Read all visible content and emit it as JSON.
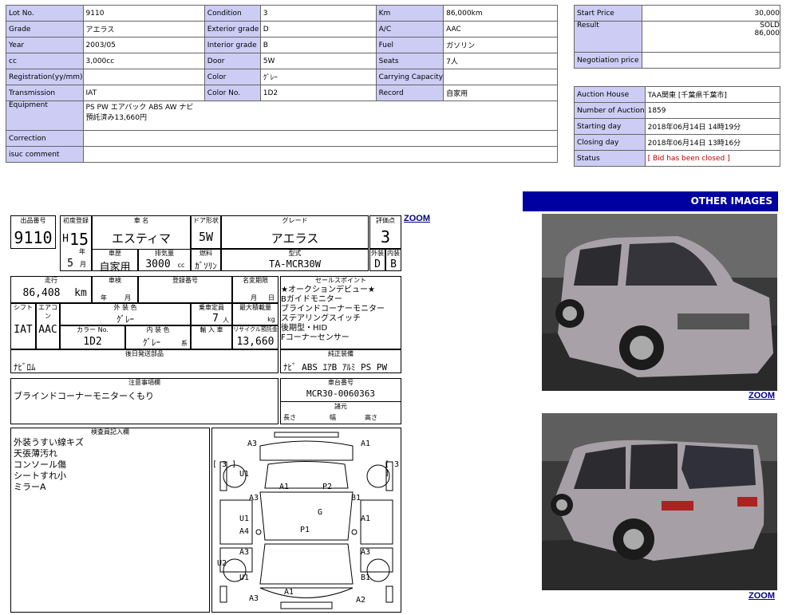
{
  "main_table": {
    "rows": [
      [
        {
          "l": "Lot No.",
          "v": "9110"
        },
        {
          "l": "Condition",
          "v": "3"
        },
        {
          "l": "Km",
          "v": "86,000km"
        }
      ],
      [
        {
          "l": "Grade",
          "v": "アエラス"
        },
        {
          "l": "Exterior grade",
          "v": "D"
        },
        {
          "l": "A/C",
          "v": "AAC"
        }
      ],
      [
        {
          "l": "Year",
          "v": "2003/05"
        },
        {
          "l": "Interior grade",
          "v": "B"
        },
        {
          "l": "Fuel",
          "v": "ガソリン"
        }
      ],
      [
        {
          "l": "cc",
          "v": "3,000cc"
        },
        {
          "l": "Door",
          "v": "5W"
        },
        {
          "l": "Seats",
          "v": "7人"
        }
      ],
      [
        {
          "l": "Registration(yy/mm)",
          "v": ""
        },
        {
          "l": "Color",
          "v": "ｸﾞﾚｰ"
        },
        {
          "l": "Carrying Capacity",
          "v": ""
        }
      ],
      [
        {
          "l": "Transmission",
          "v": "IAT"
        },
        {
          "l": "Color No.",
          "v": "1D2"
        },
        {
          "l": "Record",
          "v": "自家用"
        }
      ]
    ],
    "equipment_label": "Equipment",
    "equipment_line1": "PS PW エアバック ABS AW ナビ",
    "equipment_line2": "預託済み13,660円",
    "correction_label": "Correction",
    "correction_value": "",
    "isuc_label": "isuc comment",
    "isuc_value": ""
  },
  "price_table": {
    "start_label": "Start Price",
    "start_value": "30,000",
    "result_label": "Result",
    "result_value1": "SOLD",
    "result_value2": "86,000",
    "nego_label": "Negotiation price",
    "nego_value": ""
  },
  "auction_table": {
    "house_label": "Auction House",
    "house_value": "TAA関東 [千葉県千葉市]",
    "number_label": "Number of Auction",
    "number_value": "1859",
    "starting_label": "Starting day",
    "starting_value": "2018年06月14日 14時19分",
    "closing_label": "Closing day",
    "closing_value": "2018年06月14日 13時16分",
    "status_label": "Status",
    "status_value": "[ Bid has been closed ]"
  },
  "other_images": "OTHER IMAGES",
  "zoom": "ZOOM",
  "sheet": {
    "h_lot": "出品番号",
    "v_lot": "9110",
    "h_first": "初度登録",
    "v_era": "H",
    "v_year": "15",
    "v_nen": "年",
    "v_month": "5",
    "v_tsuki": "月",
    "h_name": "車 名",
    "v_name": "エスティマ",
    "h_door": "ドア形状",
    "v_door": "5W",
    "h_grade": "グレード",
    "v_grade": "アエラス",
    "h_score": "評価点",
    "v_score": "3",
    "h_use": "車歴",
    "v_use": "自家用",
    "h_disp": "排気量",
    "v_disp": "3000",
    "v_cc": "cc",
    "h_fuel": "燃料",
    "v_fuel": "ｶﾞｿﾘﾝ",
    "h_model": "型式",
    "v_model": "TA-MCR30W",
    "h_ext": "外装",
    "v_ext": "D",
    "h_int": "内装",
    "v_int": "B",
    "h_km": "走行",
    "v_km": "86,408",
    "v_km_unit": "km",
    "h_shaken": "車検",
    "v_shaken_y": "年",
    "v_shaken_m": "月",
    "h_reg": "登録番号",
    "h_meigi": "名変期限",
    "v_meigi_m": "月",
    "v_meigi_d": "日",
    "h_sales": "セールスポイント",
    "sales_points": [
      "★オークションデビュー★",
      "Bガイドモニター",
      "ブラインドコーナーモニター",
      "ステアリングスイッチ",
      "後期型・HID",
      "Fコーナーセンサー"
    ],
    "h_shift": "シフト",
    "h_ac": "エアコン",
    "v_shift": "IAT",
    "v_ac": "AAC",
    "h_extcolor": "外 装 色",
    "v_extcolor": "ｸﾞﾚｰ",
    "h_capacity": "乗車定員",
    "v_capacity": "7",
    "v_capacity_unit": "人",
    "h_load": "最大積載量",
    "v_load_unit": "kg",
    "h_colorno": "カラー No.",
    "v_colorno": "1D2",
    "h_intcolor": "内 装 色",
    "v_intcolor": "ｸﾞﾚｰ",
    "v_intcolor_unit": "系",
    "h_import": "輸 入 車",
    "h_recycle": "リサイクル預託金",
    "v_recycle": "13,660",
    "h_parts": "後日発送部品",
    "v_parts": "ﾅﾋﾞﾛﾑ",
    "h_equip": "純正装備",
    "v_equip": "ﾅﾋﾞ ABS ｴｱB ｱﾙﾐ PS PW",
    "h_notes": "注意事項欄",
    "v_notes": "ブラインドコーナーモニターくもり",
    "h_chassis": "車台番号",
    "v_chassis": "MCR30-0060363",
    "h_dims": "諸元",
    "v_len": "長さ",
    "v_wid": "幅",
    "v_hgt": "高さ",
    "h_inspector": "検査員記入欄",
    "inspector_notes": [
      "外装うすい線キズ",
      "天張薄汚れ",
      "コンソール傷",
      "シートすれ小",
      "ミラーA"
    ],
    "diagram_marks": [
      "A3",
      "A1",
      "[ 3 ]",
      "[ 3 ]",
      "U1",
      "A1",
      "P2",
      "B1",
      "A3",
      "G",
      "U1",
      "A4",
      "P1",
      "A1",
      "A3",
      "A3",
      "U2",
      "U1",
      "B1",
      "A3",
      "A1",
      "A2"
    ]
  }
}
